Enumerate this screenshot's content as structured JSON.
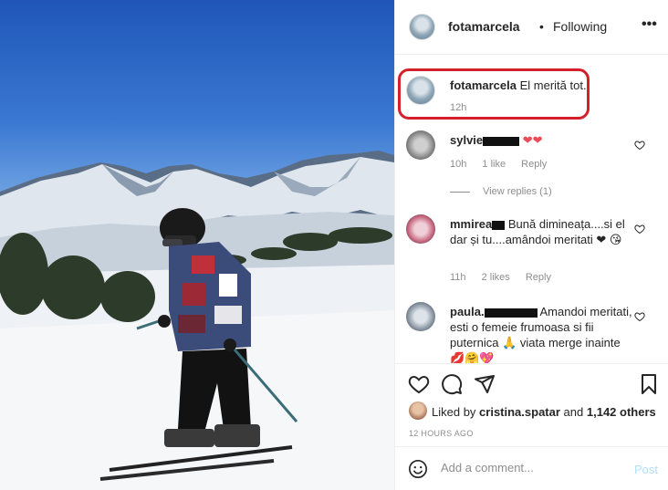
{
  "post": {
    "username": "fotamarcela",
    "separator": "•",
    "following_label": "Following",
    "more_label": "•••",
    "photo_description": "skier on snowy mountain slope"
  },
  "caption": {
    "username": "fotamarcela",
    "text": "El merită tot.",
    "time": "12h"
  },
  "comments": [
    {
      "username": "sylvie",
      "text": "❤❤",
      "time": "10h",
      "likes": "1 like",
      "reply_label": "Reply"
    },
    {
      "username": "mmirea",
      "text": "Bună dimineața....si el dar și tu....amândoi meritati ❤ 😘",
      "time": "11h",
      "likes": "2 likes",
      "reply_label": "Reply"
    },
    {
      "username": "paula.",
      "text": "Amandoi meritati, esti o femeie frumoasa si fii puternica 🙏 viata merge inainte 💋🤗💖"
    }
  ],
  "view_replies": "View replies (1)",
  "liked_by": {
    "prefix": "Liked by",
    "user": "cristina.spatar",
    "and": "and",
    "others": "1,142 others"
  },
  "timestamp": "12 HOURS AGO",
  "add_comment": {
    "placeholder": "Add a comment...",
    "post_label": "Post"
  },
  "colors": {
    "highlight": "#d3202a",
    "like_heart": "#ed4956",
    "post_disabled": "#b2dffc"
  }
}
